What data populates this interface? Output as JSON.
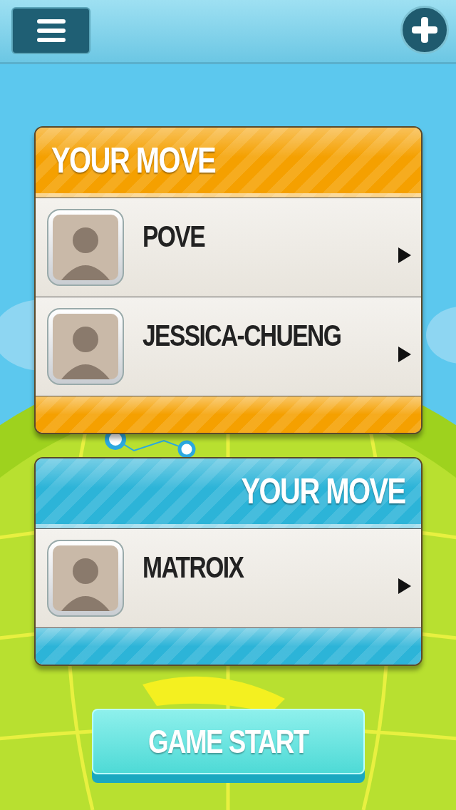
{
  "groups": [
    {
      "title": "YOUR MOVE",
      "color": "#f5a000",
      "players": [
        {
          "name": "POVE"
        },
        {
          "name": "JESSICA-CHUENG"
        }
      ]
    },
    {
      "title": "YOUR MOVE",
      "color": "#2cb4d8",
      "players": [
        {
          "name": "MATROIX"
        }
      ]
    }
  ],
  "start_button": "GAME START"
}
